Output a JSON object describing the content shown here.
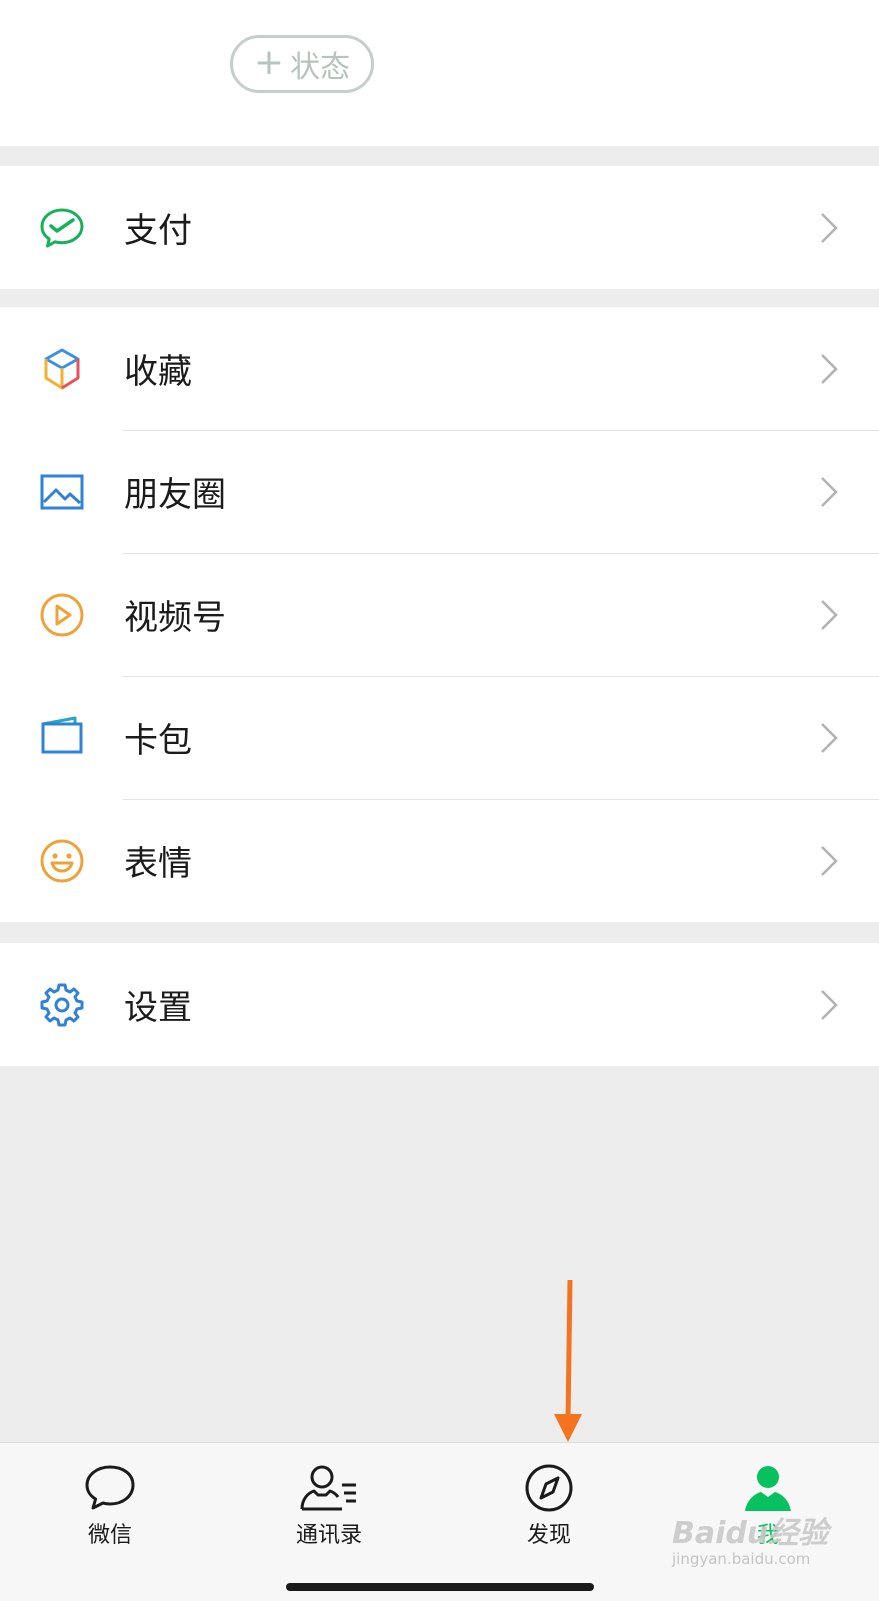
{
  "header": {
    "status_button": "状态",
    "status_plus": "+"
  },
  "pay": {
    "label": "支付"
  },
  "menu": {
    "favorites": "收藏",
    "moments": "朋友圈",
    "channels": "视频号",
    "cards": "卡包",
    "stickers": "表情"
  },
  "settings": {
    "label": "设置"
  },
  "tabbar": {
    "items": [
      {
        "label": "微信",
        "icon": "chat-bubble-icon",
        "active": false
      },
      {
        "label": "通讯录",
        "icon": "contacts-icon",
        "active": false
      },
      {
        "label": "发现",
        "icon": "compass-icon",
        "active": false
      },
      {
        "label": "我",
        "icon": "person-icon",
        "active": true
      }
    ]
  },
  "watermark": {
    "brand": "Baidu经验",
    "url": "jingyan.baidu.com"
  },
  "colors": {
    "accent": "#07c160",
    "annotation_arrow": "#f47321",
    "background": "#ededed"
  }
}
